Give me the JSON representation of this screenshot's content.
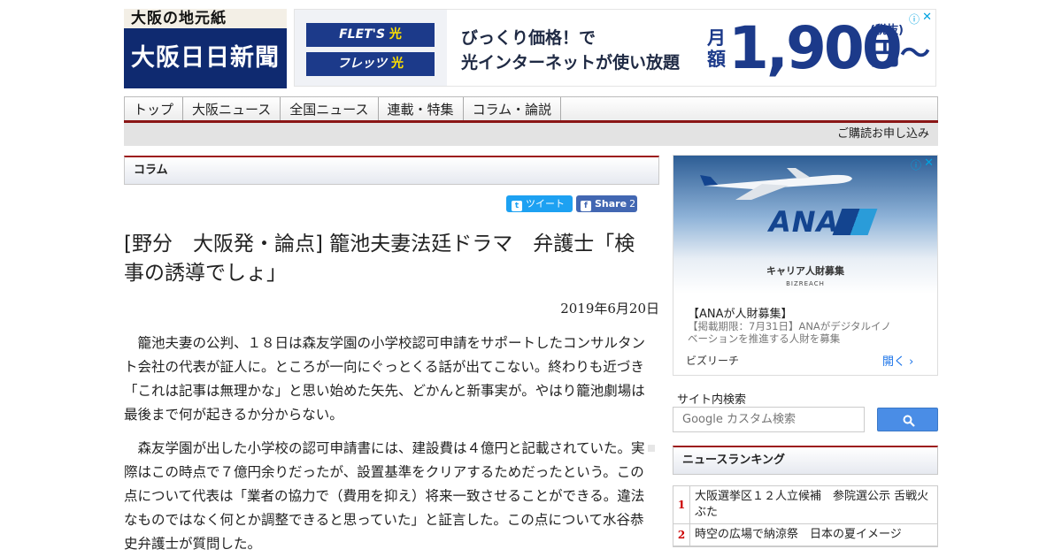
{
  "logo": {
    "tagline": "大阪の地元紙",
    "name": "大阪日日新聞"
  },
  "top_ad": {
    "brand_en_a": "FLET'S",
    "brand_en_b": "光",
    "brand_ja_a": "フレッツ",
    "brand_ja_b": "光",
    "line1": "びっくり価格！で",
    "line2": "光インターネットが使い放題",
    "price_prefix": "月額",
    "price": "1,900",
    "unit": "円〜",
    "tax": "(税抜)",
    "info": "ⓘ",
    "close": "✕"
  },
  "nav": {
    "items": [
      "トップ",
      "大阪ニュース",
      "全国ニュース",
      "連載・特集",
      "コラム・論説"
    ],
    "subscribe": "ご購読お申し込み"
  },
  "section": {
    "title": "コラム"
  },
  "share": {
    "tweet": "ツイート",
    "fb": "Share",
    "fb_count": "2"
  },
  "article": {
    "title": "[野分　大阪発・論点] 籠池夫妻法廷ドラマ　弁護士「検事の誘導でしょ」",
    "date": "2019年6月20日",
    "paragraphs": [
      "籠池夫妻の公判、１８日は森友学園の小学校認可申請をサポートしたコンサルタント会社の代表が証人に。ところが一向にぐっとくる話が出てこない。終わりも近づき「これは記事は無理かな」と思い始めた矢先、どかんと新事実が。やはり籠池劇場は最後まで何が起きるか分からない。",
      "森友学園が出した小学校の認可申請書には、建設費は４億円と記載されていた。実際はこの時点で７億円余りだったが、設置基準をクリアするためだったという。この点について代表は「業者の協力で（費用を抑え）将来一致させることができる。違法なものではなく何とか調整できると思っていた」と証言した。この点について水谷恭史弁護士が質問した。"
    ]
  },
  "side_ad": {
    "logo": "ANA",
    "sub": "キャリア人財募集",
    "brand": "BIZREACH",
    "title": "【ANAが人財募集】",
    "desc": "【掲載期限：7月31日】ANAがデジタルイノベーションを推進する人財を募集",
    "advertiser": "ビズリーチ",
    "open": "開く",
    "info": "ⓘ",
    "close": "✕"
  },
  "search": {
    "label": "サイト内検索",
    "placeholder": "Google カスタム検索"
  },
  "ranking": {
    "title": "ニュースランキング",
    "items": [
      {
        "rank": "1",
        "text": "大阪選挙区１２人立候補　参院選公示 舌戦火ぶた"
      },
      {
        "rank": "2",
        "text": "時空の広場で納涼祭　日本の夏イメージ"
      }
    ]
  }
}
